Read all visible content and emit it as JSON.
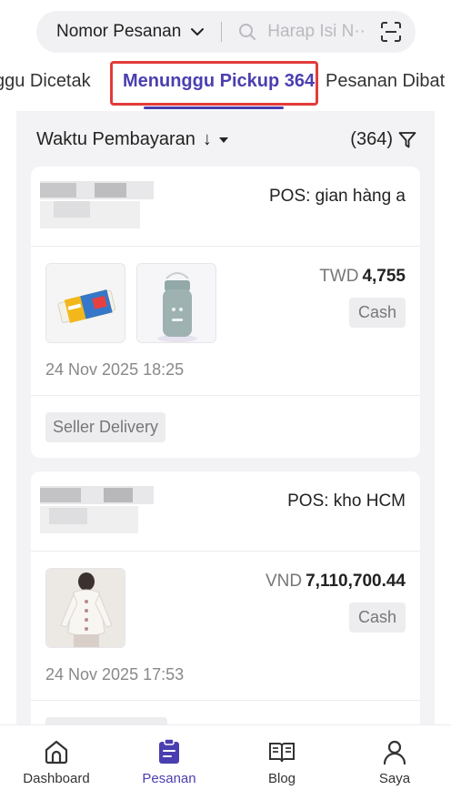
{
  "search": {
    "type_label": "Nomor Pesanan",
    "placeholder": "Harap Isi N···"
  },
  "tabs": [
    {
      "label": "ggu Dicetak"
    },
    {
      "label": "Menunggu Pickup 364"
    },
    {
      "label": "Pesanan Dibat"
    }
  ],
  "sort": {
    "label": "Waktu Pembayaran",
    "arrow": "↓",
    "count": "(364)"
  },
  "orders": [
    {
      "pos": "POS: gian hàng a",
      "currency": "TWD",
      "amount": "4,755",
      "payment": "Cash",
      "time": "24 Nov 2025 18:25",
      "delivery": "Seller Delivery"
    },
    {
      "pos": "POS: kho HCM",
      "currency": "VND",
      "amount": "7,110,700.44",
      "payment": "Cash",
      "time": "24 Nov 2025 17:53"
    }
  ],
  "nav": [
    {
      "label": "Dashboard",
      "icon": "home-icon"
    },
    {
      "label": "Pesanan",
      "icon": "orders-icon"
    },
    {
      "label": "Blog",
      "icon": "book-icon"
    },
    {
      "label": "Saya",
      "icon": "user-icon"
    }
  ],
  "colors": {
    "accent": "#4a3fb0",
    "highlight": "#e23b3b"
  }
}
